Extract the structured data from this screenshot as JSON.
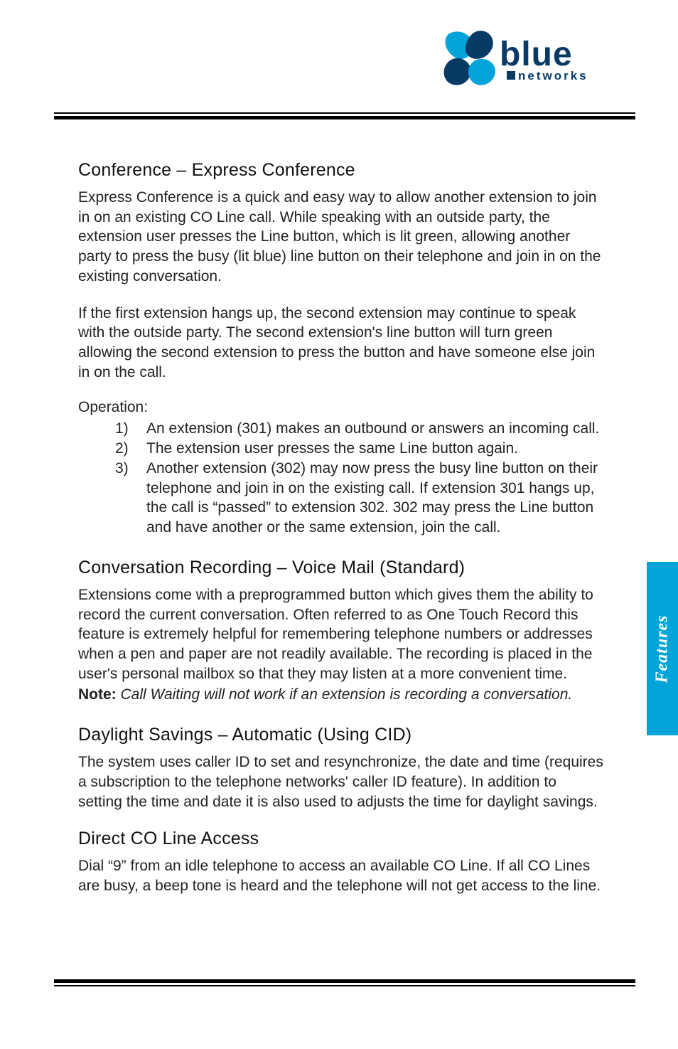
{
  "logo": {
    "brand_main": "blue",
    "brand_sub": "networks"
  },
  "side_tab": "Features",
  "sections": {
    "s1": {
      "title": "Conference – Express Conference",
      "p1": "Express Conference is a quick and easy way to allow another extension to join in on an existing CO Line call. While speaking with an outside party, the extension user presses the Line button, which is lit green, allowing another party to press the busy (lit blue) line button on their telephone and join in on the existing conversation.",
      "p2": "If the first extension hangs up, the second extension may continue to speak with the outside party.  The second extension's line button will turn green allowing the second extension to press the button and have someone else join in on the call.",
      "op_label": "Operation:",
      "steps": [
        {
          "n": "1)",
          "t": "An extension (301) makes an outbound or answers an incoming call."
        },
        {
          "n": "2)",
          "t": "The extension user presses the same Line button again."
        },
        {
          "n": "3)",
          "t": "Another extension (302) may now press the busy line button on their telephone and join in on the existing call. If extension 301 hangs up, the call is “passed” to extension 302. 302 may press the Line button and have another or the same extension, join the call."
        }
      ]
    },
    "s2": {
      "title": "Conversation Recording – Voice Mail (Standard)",
      "p1": "Extensions come with a preprogrammed button which gives them the ability to record the current conversation.  Often referred to as One Touch Record this feature is extremely helpful for remembering telephone numbers or addresses when a pen and paper are not readily available.  The recording is placed in the user's personal mailbox so that they may listen at a more convenient time.",
      "note_label": "Note:",
      "note_body": " Call Waiting will not work if an extension is recording a conversation."
    },
    "s3": {
      "title": "Daylight Savings – Automatic (Using CID)",
      "p1": "The system uses caller ID to set and resynchronize, the date and time (requires a subscription to the telephone networks' caller ID feature).  In addition to setting the time and date it is also used to adjusts the time for daylight savings."
    },
    "s4": {
      "title": "Direct CO Line Access",
      "p1": "Dial “9” from an idle telephone to access an available CO Line. If all CO Lines are busy, a beep tone is heard and the telephone will not get access to the line."
    }
  }
}
